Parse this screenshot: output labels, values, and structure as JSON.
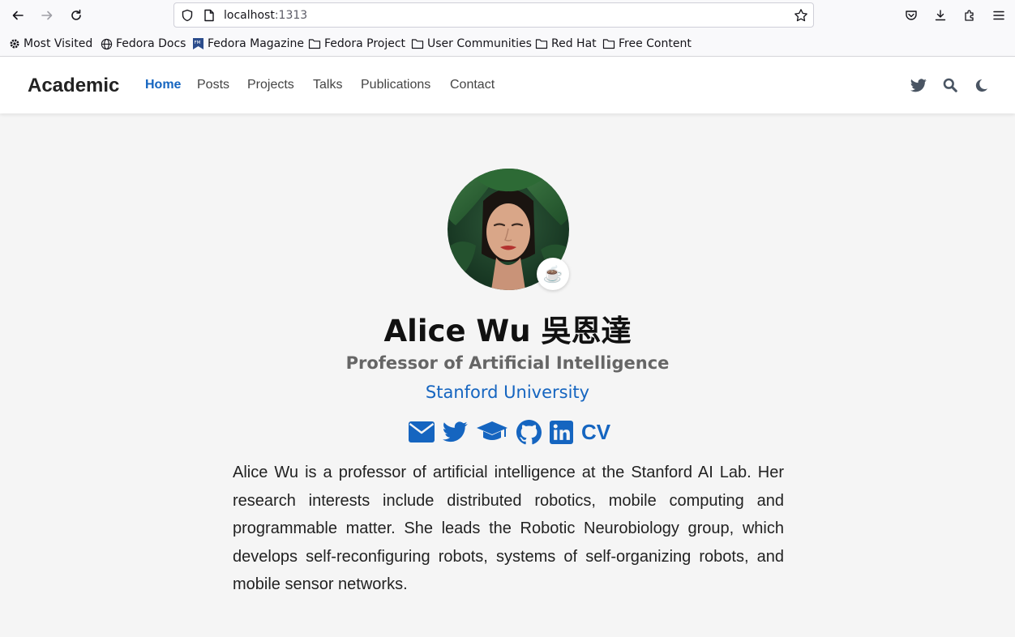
{
  "browser": {
    "url_host": "localhost",
    "url_port": ":1313",
    "bookmarks": [
      "Most Visited",
      "Fedora Docs",
      "Fedora Magazine",
      "Fedora Project",
      "User Communities",
      "Red Hat",
      "Free Content"
    ]
  },
  "site": {
    "brand": "Academic",
    "nav": [
      "Home",
      "Posts",
      "Projects",
      "Talks",
      "Publications",
      "Contact"
    ],
    "active_nav": "Home",
    "accent": "#1565c0"
  },
  "profile": {
    "status_emoji": "☕",
    "name": "Alice Wu 吳恩達",
    "role": "Professor of Artificial Intelligence",
    "organization": "Stanford University",
    "social_icons": [
      "envelope-icon",
      "twitter-icon",
      "graduation-cap-icon",
      "github-icon",
      "linkedin-icon"
    ],
    "cv_label": "CV",
    "bio": "Alice Wu is a professor of artificial intelligence at the Stanford AI Lab. Her research interests include distributed robotics, mobile computing and programmable matter. She leads the Robotic Neurobiology group, which develops self-reconfiguring robots, systems of self-organizing robots, and mobile sensor networks."
  }
}
